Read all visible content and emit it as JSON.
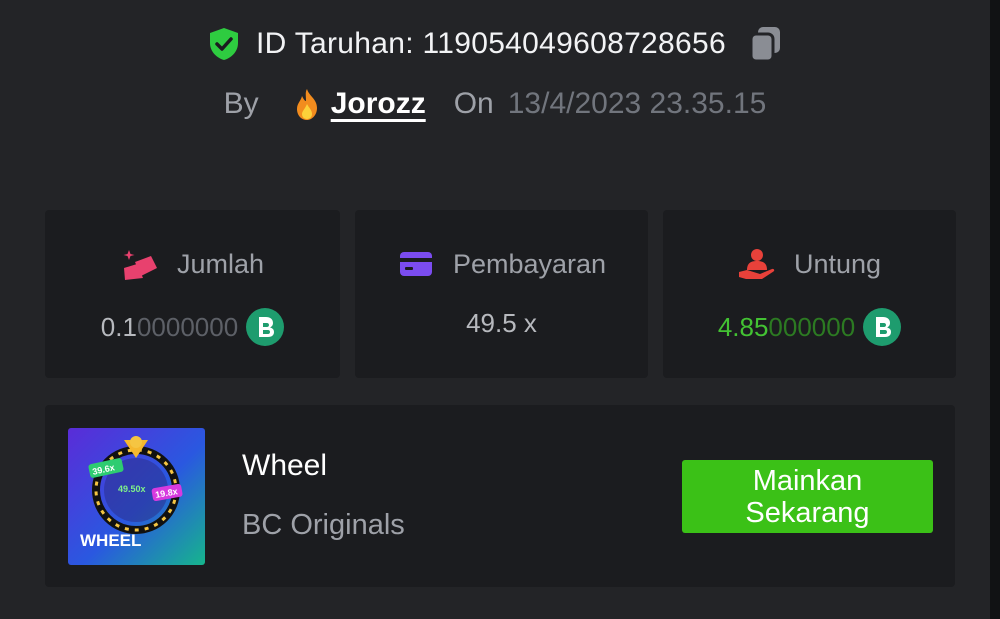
{
  "bet": {
    "id_text": "ID Taruhan: 119054049608728656",
    "by_label": "By",
    "user_name": "Jorozz",
    "on_label": "On",
    "date": "13/4/2023 23.35.15"
  },
  "stats": [
    {
      "label": "Jumlah",
      "value_main": "0.1",
      "value_dim": "0000000",
      "icon": "bet-amount-icon"
    },
    {
      "label": "Pembayaran",
      "value_main": "49.5 x",
      "value_dim": "",
      "icon": "card-icon"
    },
    {
      "label": "Untung",
      "value_main": "4.85",
      "value_dim": "000000",
      "icon": "profit-hand-icon"
    }
  ],
  "game": {
    "title": "Wheel",
    "provider": "BC Originals",
    "thumb_text": "WHEEL",
    "thumb_values": [
      "39.6x",
      "49.50x",
      "19.8x"
    ],
    "play_label": "Mainkan Sekarang"
  },
  "colors": {
    "background": "#232427",
    "card": "#1b1c1f",
    "accent_green": "#3bc117",
    "profit_green": "#43c233",
    "coin_green": "#1e9c6e"
  }
}
